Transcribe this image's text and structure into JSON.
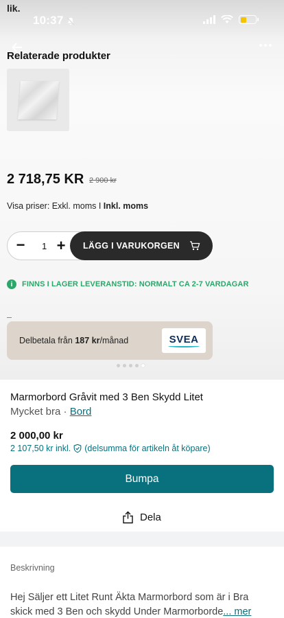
{
  "crop_text": "lik.",
  "status_bar": {
    "time": "10:37"
  },
  "store": {
    "related_title": "Relaterade produkter",
    "price": "2 718,75 KR",
    "old_price": "2 900 kr",
    "vat_label": "Visa priser: Exkl. moms I",
    "vat_active": "Inkl. moms",
    "qty_minus": "−",
    "qty_value": "1",
    "qty_plus": "+",
    "add_to_cart": "LÄGG I VARUKORGEN",
    "stock_icon": "i",
    "stock_text": "FINNS I LAGER LEVERANSTID: NORMALT CA 2-7 VARDAGAR",
    "installment_prefix": "Delbetala från",
    "installment_amount": "187 kr",
    "installment_suffix": "/månad",
    "installment_brand": "SVEA"
  },
  "listing": {
    "title": "Marmorbord Gråvit med 3 Ben Skydd Litet",
    "condition": "Mycket bra",
    "separator": " · ",
    "category": "Bord",
    "price": "2 000,00 kr",
    "price_incl": "2 107,50 kr inkl.",
    "protection_note": "(delsumma för artikeln åt köpare)",
    "bump_button": "Bumpa",
    "share_button": "Dela"
  },
  "description": {
    "heading": "Beskrivning",
    "line1": "Hej Säljer ett Litet Runt Äkta Marmorbord som är i Bra",
    "line2": "skick med 3 Ben och skydd Under Marmorborde",
    "more": "... mer"
  },
  "icons": {
    "bell": "bell-slash-icon",
    "back": "arrow-left-icon",
    "more": "more-dots-icon",
    "cart": "cart-icon",
    "shield": "shield-check-icon",
    "share": "share-icon"
  },
  "colors": {
    "accent": "#09707d",
    "stock_green": "#2aa769",
    "cart_button": "#2a2a2a",
    "payment_card": "#ddd5cc"
  }
}
